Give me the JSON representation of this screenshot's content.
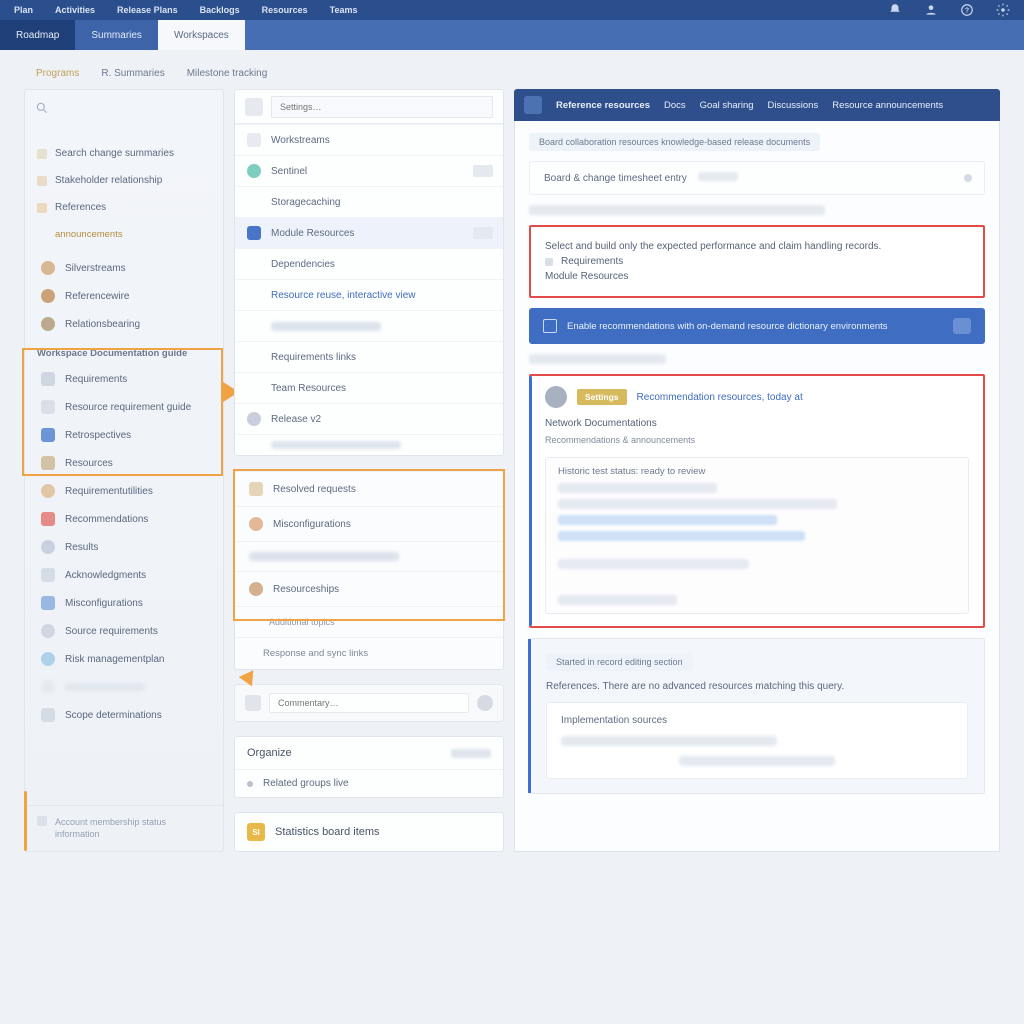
{
  "topnav": {
    "items": [
      "Plan",
      "Activities",
      "Release Plans",
      "Backlogs",
      "Resources",
      "Teams"
    ]
  },
  "subnav": {
    "tabs": [
      "Roadmap",
      "Summaries",
      "Workspaces"
    ]
  },
  "breadcrumbs": [
    "Programs",
    "R. Summaries",
    "Milestone tracking"
  ],
  "sidebar": {
    "top_items": [
      {
        "label": "Search change summaries"
      },
      {
        "label": "Stakeholder relationship"
      },
      {
        "label": "References"
      }
    ],
    "sub_item": "announcements",
    "people_title": "",
    "people": [
      {
        "name": "Silverstreams"
      },
      {
        "name": "Referencewire"
      },
      {
        "name": "Relationsbearing"
      }
    ],
    "group2_title": "Workspace Documentation guide",
    "group2": [
      {
        "label": "Requirements"
      },
      {
        "label": "Resource requirement guide"
      },
      {
        "label": "Retrospectives"
      },
      {
        "label": "Resources"
      },
      {
        "label": "Requirementutilities"
      },
      {
        "label": "Recommendations"
      },
      {
        "label": "Results"
      },
      {
        "label": "Acknowledgments"
      },
      {
        "label": "Misconfigurations"
      },
      {
        "label": "Source requirements"
      },
      {
        "label": "Risk managementplan"
      },
      {
        "label": "Scope determinations"
      }
    ],
    "footer": "Account membership status information"
  },
  "middle": {
    "search_placeholder": "Settings…",
    "items1": [
      {
        "label": "Workstreams",
        "color": ""
      },
      {
        "label": "Sentinel",
        "color": "#7ecec0",
        "badge": true
      },
      {
        "label": "Storagecaching",
        "color": ""
      },
      {
        "label": "Module Resources",
        "color": "#4a74c8",
        "active": true,
        "badge": true
      },
      {
        "label": "Dependencies",
        "color": ""
      },
      {
        "label": "Resource reuse, interactive view",
        "color": "",
        "link": true
      },
      {
        "label": "",
        "color": "",
        "blurred": true
      },
      {
        "label": "Requirements links",
        "color": ""
      },
      {
        "label": "Team Resources",
        "color": ""
      },
      {
        "label": "Release v2",
        "color": "#c8cedb"
      },
      {
        "label": "",
        "color": "",
        "blurred": true,
        "small": true
      }
    ],
    "items2": [
      {
        "label": "Resolved requests"
      },
      {
        "label": "Misconfigurations"
      },
      {
        "label": "Resourceships"
      },
      {
        "label": "Additional topics"
      },
      {
        "label": "Response and sync links"
      }
    ],
    "compose_placeholder": "Commentary…",
    "chip_row": {
      "label": "Organize"
    },
    "expand": {
      "label": "Related groups live"
    },
    "bottom": {
      "label": "Statistics board items",
      "icon_text": "SI"
    }
  },
  "right": {
    "header_tabs": [
      "Reference resources",
      "Docs",
      "Goal sharing",
      "Discussions",
      "Resource announcements"
    ],
    "notice_pill": "Board collaboration resources knowledge-based release documents",
    "card1": "Board & change timesheet entry",
    "redbox1": {
      "line1": "Select and build only the expected performance and claim handling records.",
      "line2": "Requirements",
      "line3": "Module Resources"
    },
    "banner": "Enable recommendations with on-demand resource dictionary environments",
    "post": {
      "tag": "Settings",
      "title": "Recommendation resources, today at",
      "line_a": "Network Documentations",
      "line_b": "Recommendations & announcements",
      "inner_top": "Historic test status: ready to review"
    },
    "bottom_card": {
      "pill": "Started in record editing section",
      "line1": "References. There are no advanced resources matching this query.",
      "inner": "Implementation sources"
    }
  }
}
